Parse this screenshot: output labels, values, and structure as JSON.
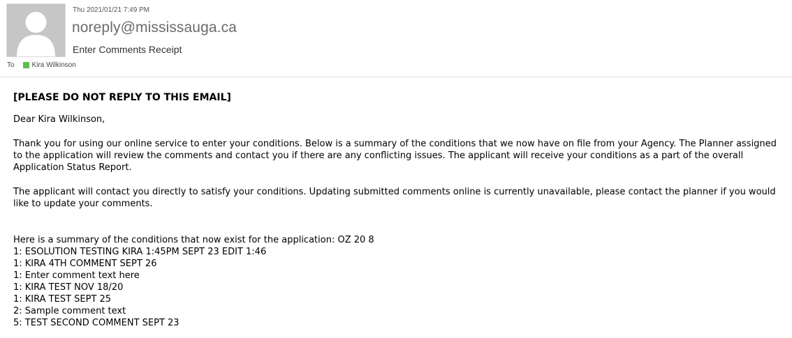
{
  "header": {
    "timestamp": "Thu 2021/01/21 7:49 PM",
    "sender": "noreply@mississauga.ca",
    "subject": "Enter Comments Receipt",
    "to_label": "To",
    "recipient": "Kira Wilkinson",
    "presence_color": "#5dbf4a",
    "avatar_icon": "default-person-avatar"
  },
  "body": {
    "banner": "[PLEASE DO NOT REPLY TO THIS EMAIL]",
    "greeting": "Dear Kira Wilkinson,",
    "paragraph1": "Thank you for using our online service to enter your conditions. Below is a summary of the conditions that we now have on file from your Agency. The Planner assigned to the application will review the comments and contact you if there are any conflicting issues. The applicant will receive your conditions as a part of the overall Application Status Report.",
    "paragraph2": "The applicant will contact you directly to satisfy your conditions. Updating submitted comments online is currently unavailable, please contact the planner if you would like to update your comments.",
    "summary_intro": "Here is a summary of the conditions that now exist for the application: OZ 20 8",
    "conditions": [
      "1: ESOLUTION TESTING KIRA 1:45PM SEPT 23 EDIT 1:46",
      "1: KIRA 4TH COMMENT SEPT 26",
      "1: Enter comment text here",
      "1: KIRA TEST NOV 18/20",
      "1: KIRA TEST SEPT 25",
      "2: Sample comment text",
      "5: TEST SECOND COMMENT SEPT 23"
    ]
  }
}
